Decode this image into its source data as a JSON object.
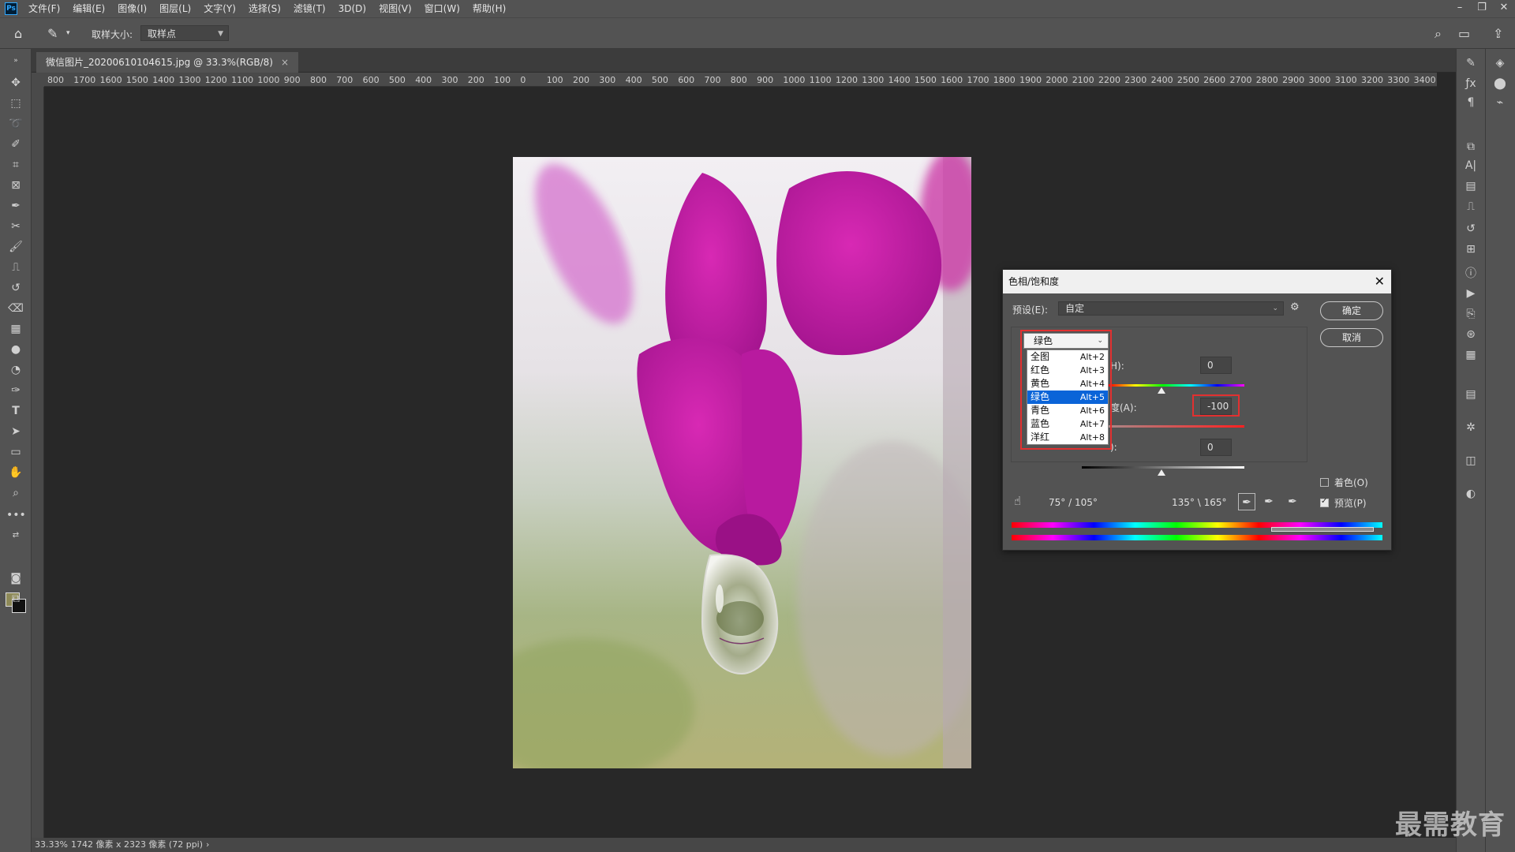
{
  "menubar": {
    "logo": "Ps",
    "items": [
      "文件(F)",
      "编辑(E)",
      "图像(I)",
      "图层(L)",
      "文字(Y)",
      "选择(S)",
      "滤镜(T)",
      "3D(D)",
      "视图(V)",
      "窗口(W)",
      "帮助(H)"
    ],
    "window_controls": [
      "–",
      "❐",
      "✕"
    ]
  },
  "options": {
    "sample_size_label": "取样大小:",
    "sample_size_value": "取样点"
  },
  "document": {
    "tab_title": "微信图片_20200610104615.jpg @ 33.3%(RGB/8)",
    "tab_close": "×"
  },
  "ruler": {
    "ticks": [
      "800",
      "1700",
      "1600",
      "1500",
      "1400",
      "1300",
      "1200",
      "1100",
      "1000",
      "900",
      "800",
      "700",
      "600",
      "500",
      "400",
      "300",
      "200",
      "100",
      "0",
      "100",
      "200",
      "300",
      "400",
      "500",
      "600",
      "700",
      "800",
      "900",
      "1000",
      "1100",
      "1200",
      "1300",
      "1400",
      "1500",
      "1600",
      "1700",
      "1800",
      "1900",
      "2000",
      "2100",
      "2200",
      "2300",
      "2400",
      "2500",
      "2600",
      "2700",
      "2800",
      "2900",
      "3000",
      "3100",
      "3200",
      "3300",
      "3400"
    ]
  },
  "status": {
    "zoom": "33.33%",
    "info": "1742 像素 x 2323 像素 (72 ppi)",
    "arrow": "›"
  },
  "dialog": {
    "title": "色相/饱和度",
    "close": "✕",
    "preset_label": "预设(E):",
    "preset_value": "自定",
    "ok": "确定",
    "cancel": "取消",
    "channel_selected": "绿色",
    "channels": [
      {
        "name": "全图",
        "shortcut": "Alt+2"
      },
      {
        "name": "红色",
        "shortcut": "Alt+3"
      },
      {
        "name": "黄色",
        "shortcut": "Alt+4"
      },
      {
        "name": "绿色",
        "shortcut": "Alt+5"
      },
      {
        "name": "青色",
        "shortcut": "Alt+6"
      },
      {
        "name": "蓝色",
        "shortcut": "Alt+7"
      },
      {
        "name": "洋红",
        "shortcut": "Alt+8"
      }
    ],
    "hue_label_partial": "H):",
    "hue_value": "0",
    "saturation_label_partial": "度(A):",
    "saturation_value": "-100",
    "lightness_label_partial": "):",
    "lightness_value": "0",
    "colorize_label": "着色(O)",
    "colorize_checked": false,
    "preview_label": "预览(P)",
    "preview_checked": true,
    "range_left": "75° / 105°",
    "range_right": "135° \\ 165°"
  },
  "watermark": "最需教育",
  "colors": {
    "highlight_red": "#e23030",
    "selection_blue": "#0a64d8",
    "ui_gray": "#535353",
    "canvas_bg": "#282828"
  }
}
